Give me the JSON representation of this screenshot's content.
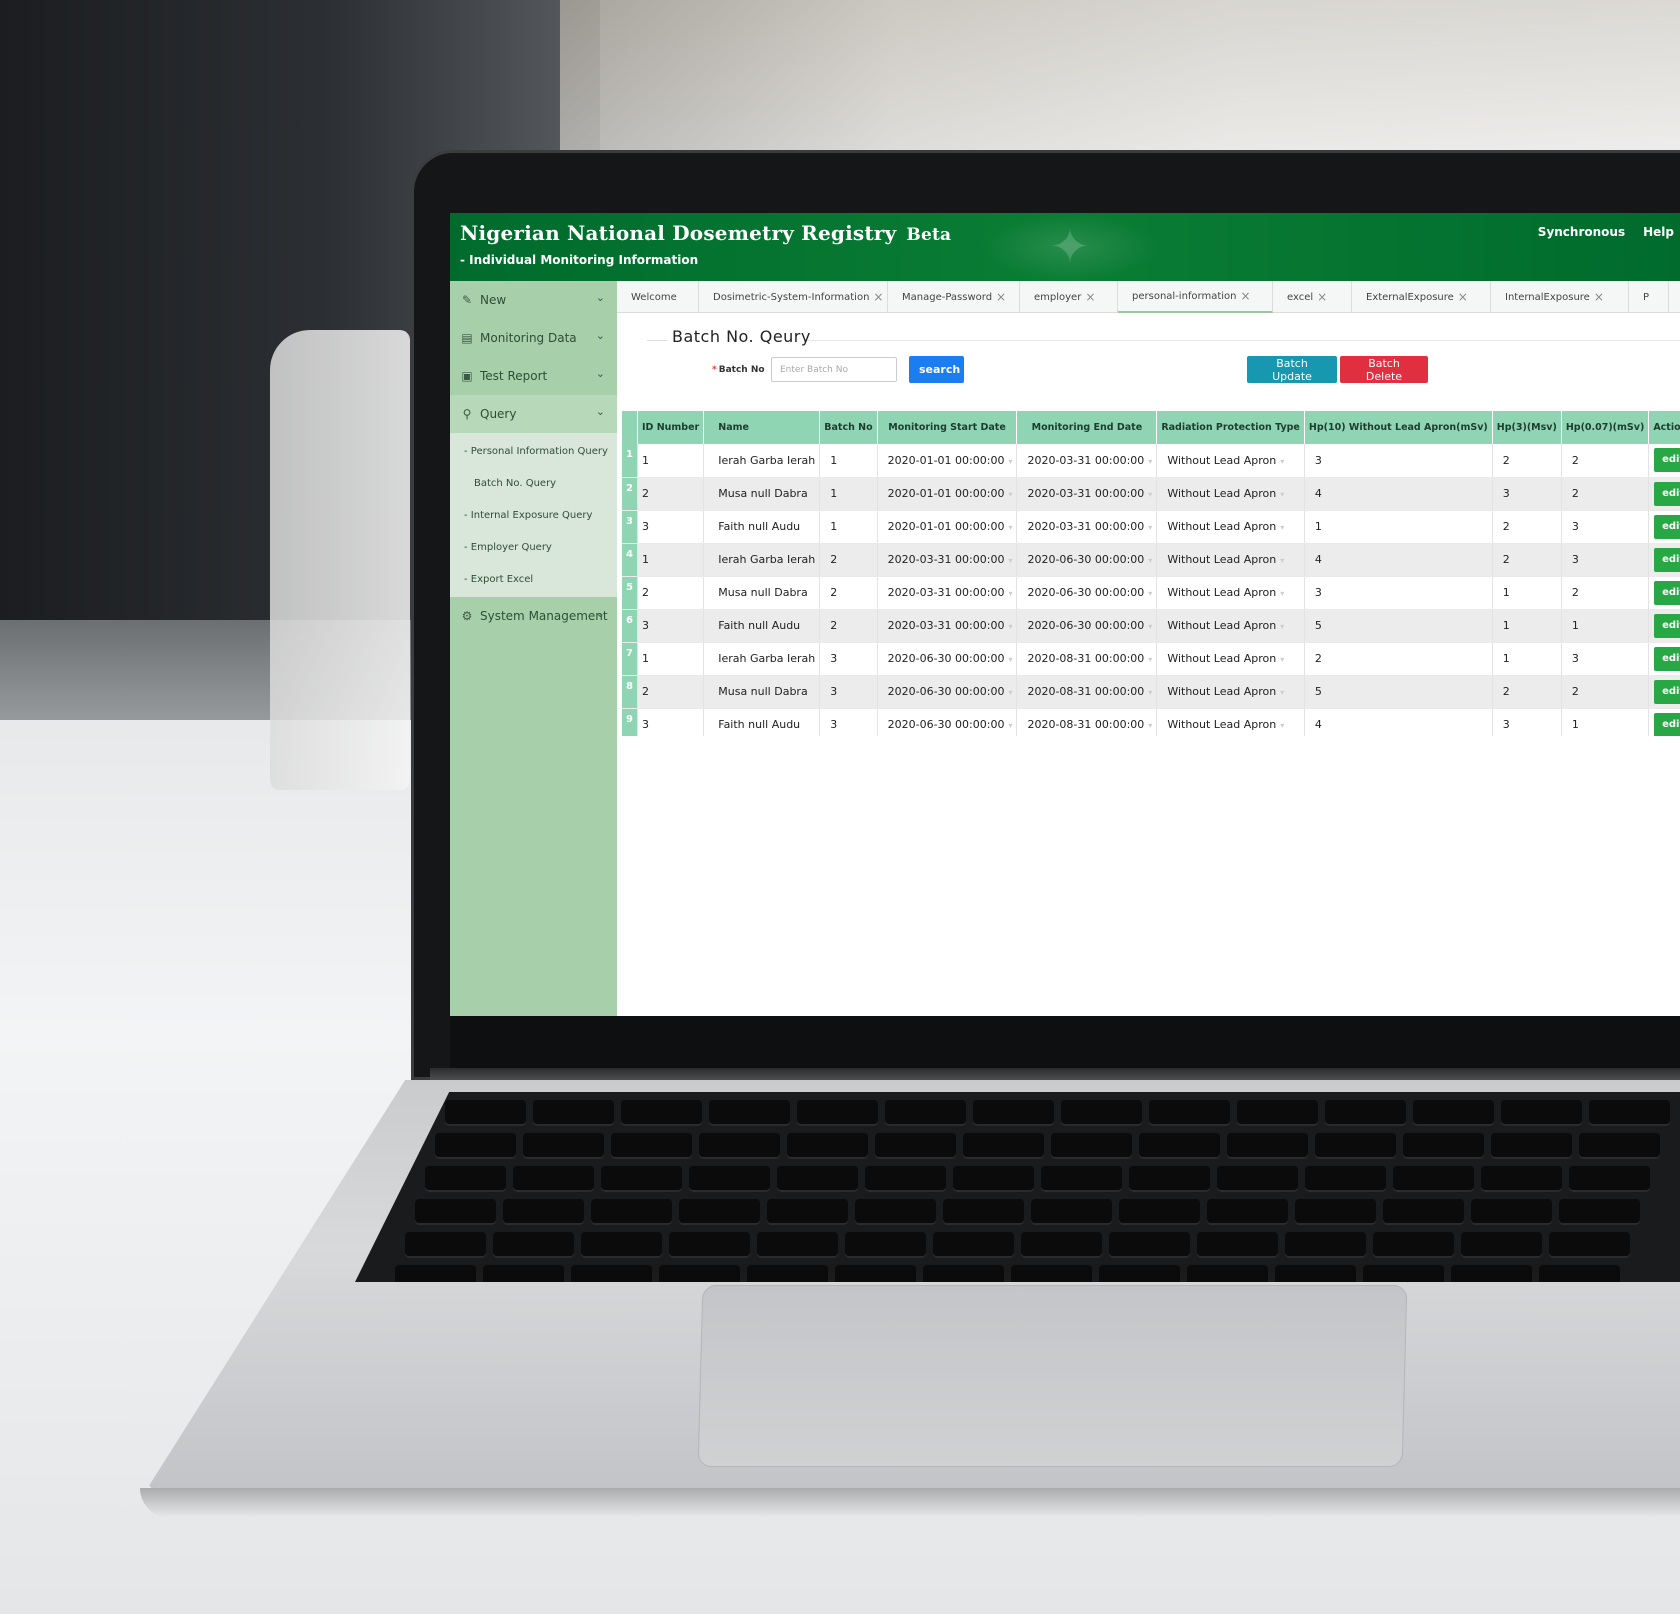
{
  "app": {
    "title": "Nigerian National Dosemetry Registry",
    "beta": "Beta",
    "subtitle": "- Individual Monitoring Information",
    "links": [
      "Synchronous",
      "Help"
    ]
  },
  "sidebar": {
    "items": [
      {
        "label": "New",
        "icon": "edit-icon"
      },
      {
        "label": "Monitoring Data",
        "icon": "database-icon"
      },
      {
        "label": "Test Report",
        "icon": "printer-icon"
      },
      {
        "label": "Query",
        "icon": "search-icon"
      }
    ],
    "query_sub": [
      {
        "label": "- Personal Information Query"
      },
      {
        "label": "Batch No. Query"
      },
      {
        "label": "- Internal Exposure Query"
      },
      {
        "label": "- Employer Query"
      },
      {
        "label": "- Export Excel"
      }
    ],
    "system": {
      "label": "System Management",
      "icon": "gear-icon"
    }
  },
  "tabs": [
    {
      "label": "Welcome"
    },
    {
      "label": "Dosimetric-System-Information"
    },
    {
      "label": "Manage-Password"
    },
    {
      "label": "employer"
    },
    {
      "label": "personal-information"
    },
    {
      "label": "excel"
    },
    {
      "label": "ExternalExposure"
    },
    {
      "label": "InternalExposure"
    },
    {
      "label": "P"
    }
  ],
  "page": {
    "title": "Batch No. Qeury",
    "search_label": "Batch No",
    "search_placeholder": "Enter Batch No",
    "search_button": "search",
    "batch_update": "Batch Update",
    "batch_delete": "Batch Delete"
  },
  "table": {
    "headers": [
      "ID Number",
      "Name",
      "Batch No",
      "Monitoring Start Date",
      "Monitoring End Date",
      "Radiation Protection Type",
      "Hp(10) Without Lead Apron(mSv)",
      "Hp(3)(Msv)",
      "Hp(0.07)(mSv)",
      "Actions"
    ],
    "edit_label": "edit",
    "rows": [
      {
        "n": "1",
        "id": "1",
        "name": "Ierah Garba Ierah",
        "batch": "1",
        "start": "2020-01-01 00:00:00",
        "end": "2020-03-31 00:00:00",
        "type": "Without Lead Apron",
        "hp10": "3",
        "hp3": "2",
        "hp007": "2"
      },
      {
        "n": "2",
        "id": "2",
        "name": "Musa null Dabra",
        "batch": "1",
        "start": "2020-01-01 00:00:00",
        "end": "2020-03-31 00:00:00",
        "type": "Without Lead Apron",
        "hp10": "4",
        "hp3": "3",
        "hp007": "2"
      },
      {
        "n": "3",
        "id": "3",
        "name": "Faith null Audu",
        "batch": "1",
        "start": "2020-01-01 00:00:00",
        "end": "2020-03-31 00:00:00",
        "type": "Without Lead Apron",
        "hp10": "1",
        "hp3": "2",
        "hp007": "3"
      },
      {
        "n": "4",
        "id": "1",
        "name": "Ierah Garba Ierah",
        "batch": "2",
        "start": "2020-03-31 00:00:00",
        "end": "2020-06-30 00:00:00",
        "type": "Without Lead Apron",
        "hp10": "4",
        "hp3": "2",
        "hp007": "3"
      },
      {
        "n": "5",
        "id": "2",
        "name": "Musa null Dabra",
        "batch": "2",
        "start": "2020-03-31 00:00:00",
        "end": "2020-06-30 00:00:00",
        "type": "Without Lead Apron",
        "hp10": "3",
        "hp3": "1",
        "hp007": "2"
      },
      {
        "n": "6",
        "id": "3",
        "name": "Faith null Audu",
        "batch": "2",
        "start": "2020-03-31 00:00:00",
        "end": "2020-06-30 00:00:00",
        "type": "Without Lead Apron",
        "hp10": "5",
        "hp3": "1",
        "hp007": "1"
      },
      {
        "n": "7",
        "id": "1",
        "name": "Ierah Garba Ierah",
        "batch": "3",
        "start": "2020-06-30 00:00:00",
        "end": "2020-08-31 00:00:00",
        "type": "Without Lead Apron",
        "hp10": "2",
        "hp3": "1",
        "hp007": "3"
      },
      {
        "n": "8",
        "id": "2",
        "name": "Musa null Dabra",
        "batch": "3",
        "start": "2020-06-30 00:00:00",
        "end": "2020-08-31 00:00:00",
        "type": "Without Lead Apron",
        "hp10": "5",
        "hp3": "2",
        "hp007": "2"
      },
      {
        "n": "9",
        "id": "3",
        "name": "Faith null Audu",
        "batch": "3",
        "start": "2020-06-30 00:00:00",
        "end": "2020-08-31 00:00:00",
        "type": "Without Lead Apron",
        "hp10": "4",
        "hp3": "3",
        "hp007": "1"
      }
    ]
  },
  "colors": {
    "header_green": "#0a7d34",
    "sidebar_green": "#a6cfaa",
    "table_header": "#8fd4b3",
    "search_blue": "#1a7ef2",
    "update_teal": "#1898b0",
    "delete_red": "#e0303f",
    "edit_green": "#28a745"
  }
}
